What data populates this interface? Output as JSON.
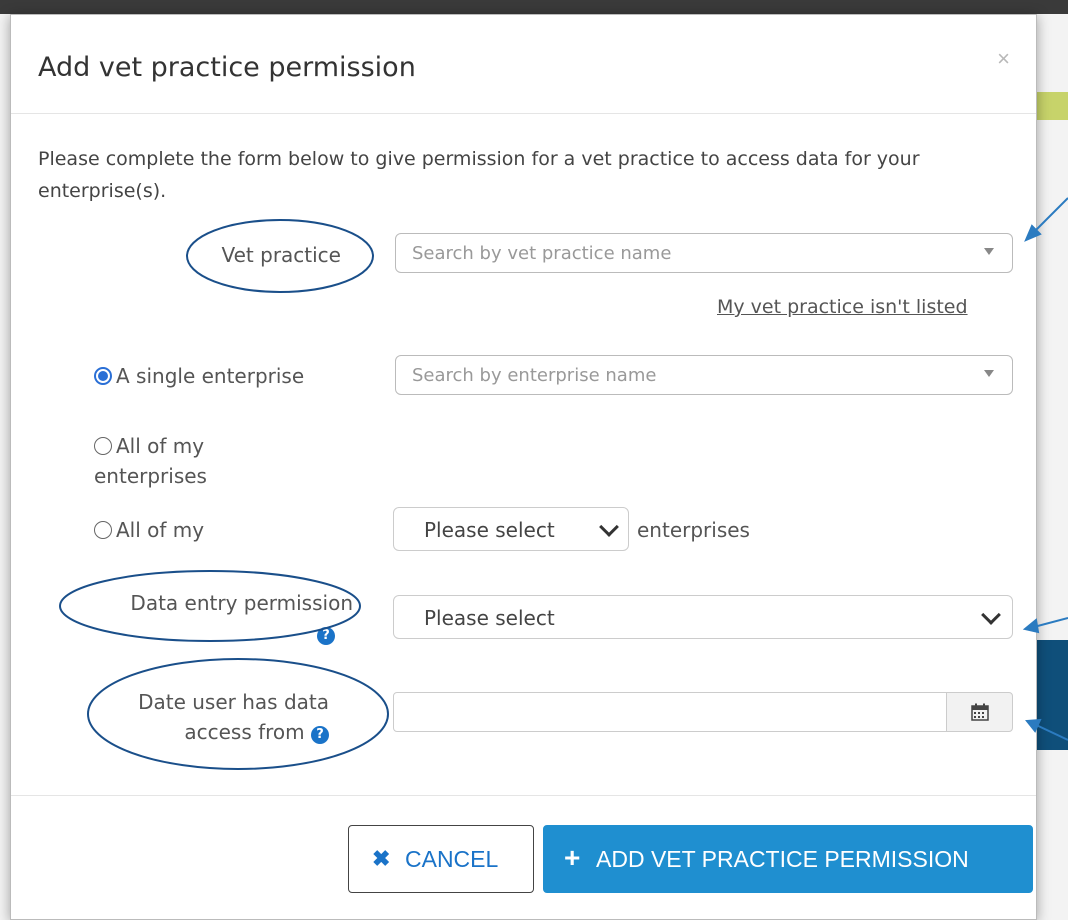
{
  "modal": {
    "title": "Add vet practice permission",
    "close_label": "×",
    "intro": "Please complete the form below to give permission for a vet practice to access data for your enterprise(s)."
  },
  "vet_practice": {
    "label": "Vet practice",
    "placeholder": "Search by vet practice name",
    "not_listed_link": "My vet practice isn't listed"
  },
  "enterprise": {
    "options": [
      {
        "label": "A single enterprise",
        "checked": true
      },
      {
        "label": "All of my enterprises",
        "checked": false
      },
      {
        "label": "All of my",
        "checked": false
      }
    ],
    "search_placeholder": "Search by enterprise name",
    "type_select_value": "Please select",
    "type_suffix": "enterprises"
  },
  "data_entry": {
    "label": "Data entry permission",
    "select_value": "Please select"
  },
  "date_access": {
    "label_line1": "Date user has data",
    "label_line2": "access from",
    "value": ""
  },
  "footer": {
    "cancel_label": "CANCEL",
    "add_label": "ADD VET PRACTICE PERMISSION"
  },
  "colors": {
    "primary": "#1f8fd0",
    "annotation": "#1a4f8a"
  }
}
